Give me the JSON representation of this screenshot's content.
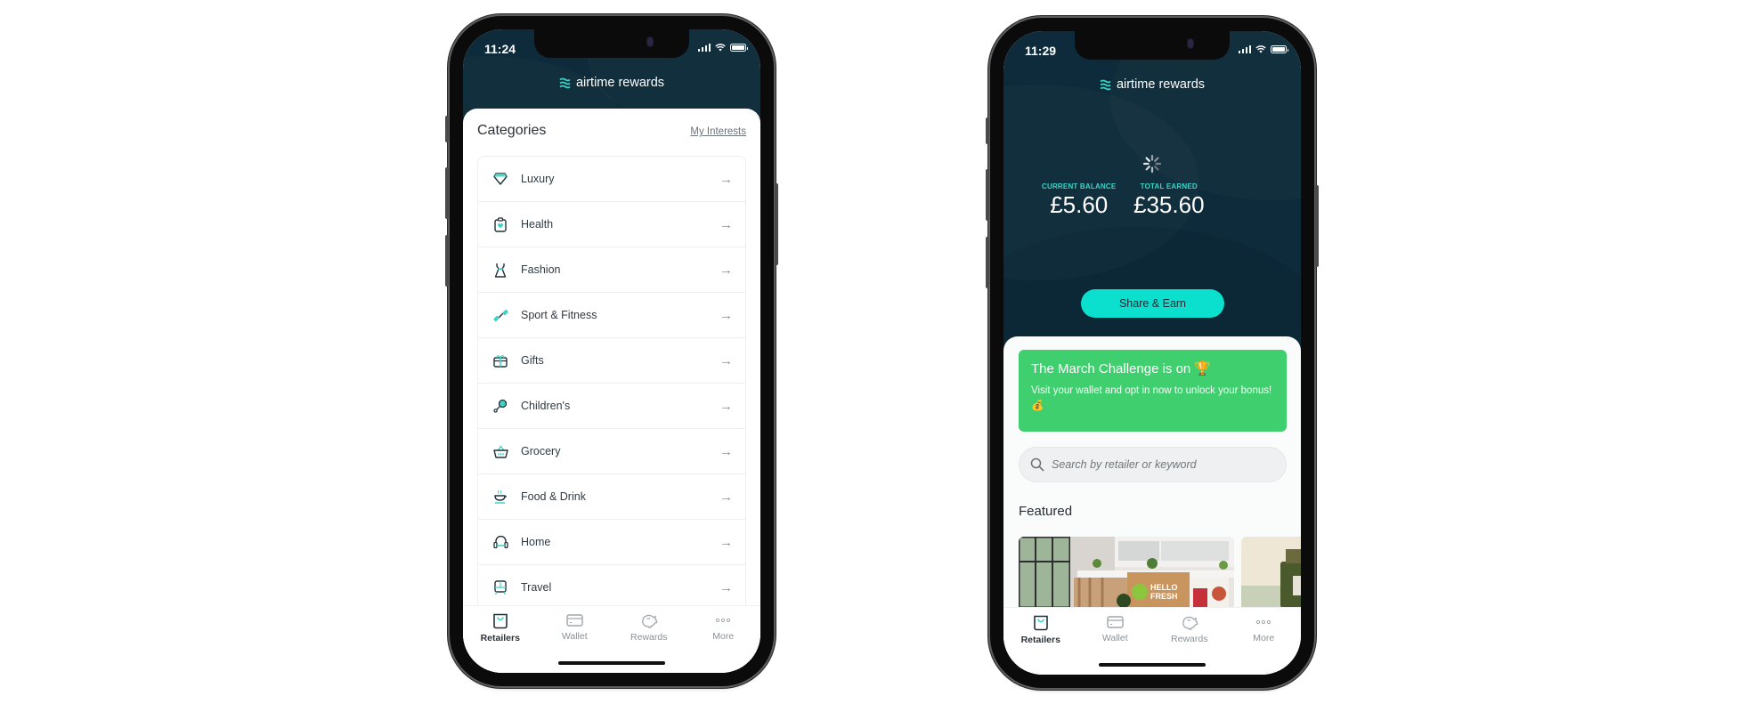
{
  "brand": {
    "name": "airtime rewards",
    "accent_teal": "#0be0cf",
    "hero_bg": "#0d2b3a",
    "banner_green": "#3fcf6f"
  },
  "left_phone": {
    "status_time": "11:24",
    "header": {
      "title": "Categories",
      "link": "My Interests"
    },
    "categories": [
      {
        "label": "Luxury",
        "icon": "diamond-icon"
      },
      {
        "label": "Health",
        "icon": "clipboard-heart-icon"
      },
      {
        "label": "Fashion",
        "icon": "dress-icon"
      },
      {
        "label": "Sport & Fitness",
        "icon": "dumbbell-icon"
      },
      {
        "label": "Gifts",
        "icon": "gift-icon"
      },
      {
        "label": "Children's",
        "icon": "rattle-icon"
      },
      {
        "label": "Grocery",
        "icon": "basket-icon"
      },
      {
        "label": "Food & Drink",
        "icon": "steaming-bowl-icon"
      },
      {
        "label": "Home",
        "icon": "armchair-icon"
      },
      {
        "label": "Travel",
        "icon": "train-icon"
      }
    ],
    "arrow_glyph": "→"
  },
  "right_phone": {
    "status_time": "11:29",
    "balance": {
      "current_label": "CURRENT BALANCE",
      "current_value": "£5.60",
      "total_label": "TOTAL EARNED",
      "total_value": "£35.60"
    },
    "share_button": "Share & Earn",
    "banner": {
      "title": "The March Challenge is on 🏆",
      "subtitle": "Visit your wallet and opt in now to unlock your bonus! 💰"
    },
    "search": {
      "placeholder": "Search by retailer or keyword",
      "value": ""
    },
    "featured": {
      "title": "Featured",
      "items": [
        {
          "brand_text_1": "HELLO",
          "brand_text_2": "FRESH"
        },
        {
          "brand_text_1": ""
        }
      ]
    }
  },
  "tabbar": {
    "tabs": [
      {
        "label": "Retailers",
        "icon": "bag-icon",
        "active": true
      },
      {
        "label": "Wallet",
        "icon": "card-icon",
        "active": false
      },
      {
        "label": "Rewards",
        "icon": "piggy-bank-icon",
        "active": false
      },
      {
        "label": "More",
        "icon": "more-dots-icon",
        "active": false
      }
    ]
  }
}
